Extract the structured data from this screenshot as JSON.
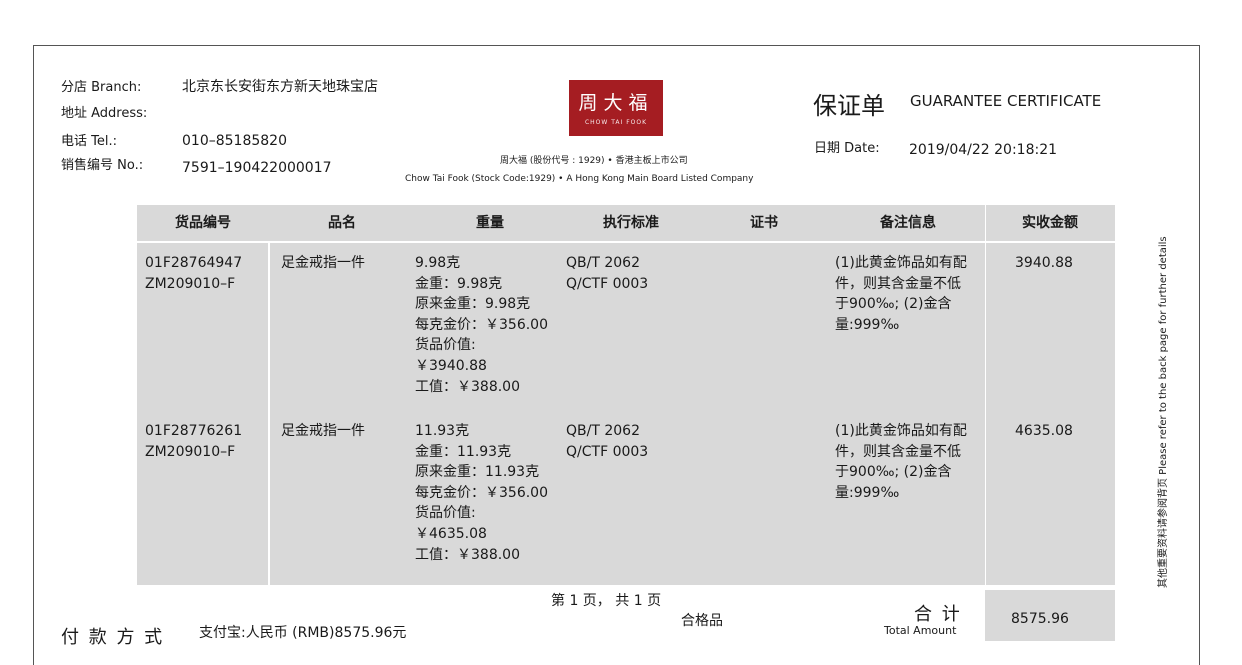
{
  "header": {
    "branch_label": "分店  Branch:",
    "branch_value": "北京东长安街东方新天地珠宝店",
    "address_label": "地址  Address:",
    "tel_label": "电话       Tel.:",
    "tel_value": "010–85185820",
    "no_label": "销售编号  No.:",
    "no_value": "7591–190422000017"
  },
  "logo": {
    "text_cn": "周大福",
    "text_en": "CHOW TAI FOOK",
    "caption_cn": "周大福 (股份代号 : 1929) • 香港主板上市公司",
    "caption_en": "Chow Tai Fook (Stock Code:1929) • A Hong Kong Main Board Listed Company"
  },
  "title": {
    "cn": "保证单",
    "en": "GUARANTEE CERTIFICATE",
    "date_label": "日期  Date:",
    "date_value": "2019/04/22 20:18:21"
  },
  "table": {
    "columns": [
      "货品编号",
      "品名",
      "重量",
      "执行标准",
      "证书",
      "备注信息",
      "实收金额"
    ],
    "rows": [
      {
        "code": "01F28764947\nZM209010–F",
        "name": "足金戒指一件",
        "weight": "9.98克\n金重：9.98克\n原来金重：9.98克\n每克金价：￥356.00\n货品价值:\n￥3940.88\n工值：￥388.00",
        "standard": "QB/T 2062\nQ/CTF 0003",
        "certificate": "",
        "remarks": "(1)此黄金饰品如有配\n件，则其含金量不低\n于900‰; (2)金含\n量:999‰",
        "amount": "3940.88"
      },
      {
        "code": "01F28776261\nZM209010–F",
        "name": "足金戒指一件",
        "weight": "11.93克\n金重：11.93克\n原来金重：11.93克\n每克金价：￥356.00\n货品价值:\n￥4635.08\n工值：￥388.00",
        "standard": "QB/T 2062\nQ/CTF 0003",
        "certificate": "",
        "remarks": "(1)此黄金饰品如有配\n件，则其含金量不低\n于900‰; (2)金含\n量:999‰",
        "amount": "4635.08"
      }
    ]
  },
  "footer": {
    "page_info": "第 1 页， 共 1 页",
    "payment_label": "付 款 方 式",
    "payment_value": "支付宝:人民币 (RMB)8575.96元",
    "quality": "合格品",
    "total_cn": "合  计",
    "total_en": "Total Amount",
    "total_value": "8575.96"
  },
  "side_note": "其他重要资料请参阅背页 Please refer to the back page for further details"
}
